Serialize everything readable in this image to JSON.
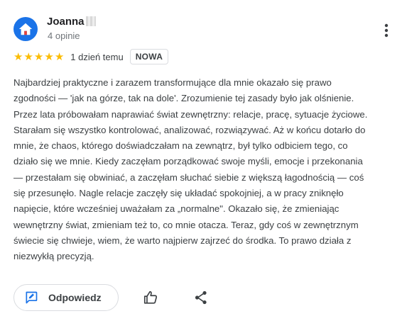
{
  "review": {
    "author": {
      "name": "Joanna",
      "meta": "4 opinie",
      "avatar_icon": "house-icon",
      "avatar_color": "#1a73e8"
    },
    "rating": 5,
    "rating_max": 5,
    "star_color": "#fbbc04",
    "time": "1 dzień temu",
    "badge": "NOWA",
    "text": "Najbardziej praktyczne i zarazem transformujące dla mnie okazało się prawo zgodności — 'jak na górze, tak na dole'. Zrozumienie tej zasady było jak olśnienie. Przez lata próbowałam naprawiać świat zewnętrzny: relacje, pracę, sytuacje życiowe. Starałam się wszystko kontrolować, analizować, rozwiązywać. Aż w końcu dotarło do mnie, że chaos, którego doświadczałam na zewnątrz, był tylko odbiciem tego, co działo się we mnie. Kiedy zaczęłam porządkować swoje myśli, emocje i przekonania — przestałam się obwiniać, a zaczęłam słuchać siebie z większą łagodnością — coś się przesunęło. Nagle relacje zaczęły się układać spokojniej, a w pracy zniknęło napięcie, które wcześniej uważałam za „normalne\". Okazało się, że zmieniając wewnętrzny świat, zmieniam też to, co mnie otacza. Teraz, gdy coś w zewnętrznym świecie się chwieje, wiem, że warto najpierw zajrzeć do środka. To prawo działa z niezwykłą precyzją."
  },
  "actions": {
    "reply_label": "Odpowiedz",
    "reply_icon": "edit-reply-icon",
    "like_icon": "thumbs-up-icon",
    "share_icon": "share-icon",
    "more_icon": "more-vert-icon"
  }
}
